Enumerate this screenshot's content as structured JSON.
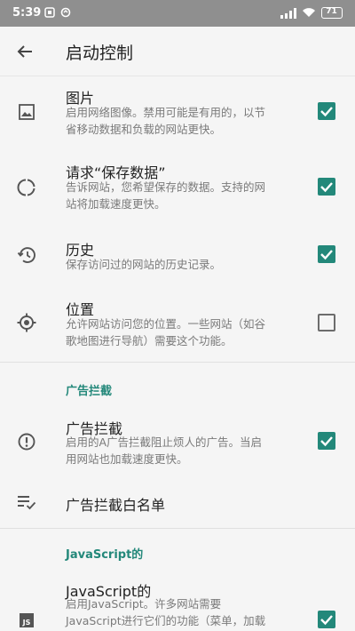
{
  "status_bar": {
    "time": "5:39",
    "battery": "71"
  },
  "app_bar": {
    "title": "启动控制",
    "back_icon": "arrow-back-icon"
  },
  "settings": [
    {
      "title": "图片",
      "summary_lines": [
        "启用网络图像。禁用可能是有用的，以节",
        "省移动数据和负载的网站更快。"
      ],
      "checked": true,
      "icon": "image-icon"
    },
    {
      "title": "请求“保存数据”",
      "summary_lines": [
        "告诉网站，您希望保存的数据。支持的网",
        "站将加载速度更快。"
      ],
      "checked": true,
      "icon": "data-saver-icon"
    },
    {
      "title": "历史",
      "summary_lines": [
        "保存访问过的网站的历史记录。"
      ],
      "checked": true,
      "icon": "history-icon"
    },
    {
      "title": "位置",
      "summary_lines": [
        "允许网站访问您的位置。一些网站（如谷",
        "歌地图进行导航）需要这个功能。"
      ],
      "checked": false,
      "icon": "location-icon"
    }
  ],
  "ad_block_section": {
    "category": "广告拦截",
    "ad_block": {
      "title": "广告拦截",
      "summary_lines": [
        "启用的A广告拦截阻止烦人的广告。当启",
        "用网站也加载速度更快。"
      ],
      "checked": true,
      "icon": "alert-circle-icon"
    },
    "whitelist": {
      "title": "广告拦截白名单",
      "icon": "playlist-check-icon"
    }
  },
  "javascript_section": {
    "category": "JavaScript的",
    "javascript": {
      "title": "JavaScript的",
      "summary_lines": [
        "启用JavaScript。许多网站需要",
        "JavaScript进行它们的功能（菜单，加载"
      ],
      "checked": true,
      "icon": "js-icon"
    }
  },
  "colors": {
    "accent": "#23887a",
    "status_bar": "#8f8f8f",
    "background": "#f5f5f5"
  }
}
